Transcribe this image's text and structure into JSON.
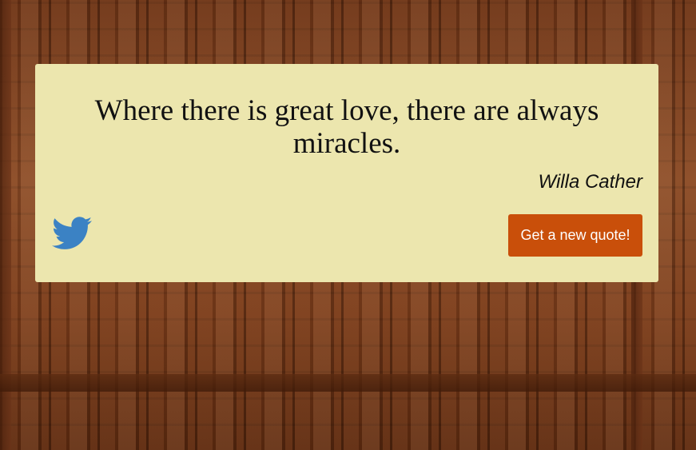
{
  "quote": {
    "text": "Where there is great love, there are always miracles.",
    "author": "Willa Cather"
  },
  "actions": {
    "tweet_icon": "twitter-bird-icon",
    "new_quote_label": "Get a new quote!"
  },
  "colors": {
    "card_background": "#ece6ae",
    "button_background": "#c94f0a",
    "twitter_blue": "#3b82c4"
  }
}
